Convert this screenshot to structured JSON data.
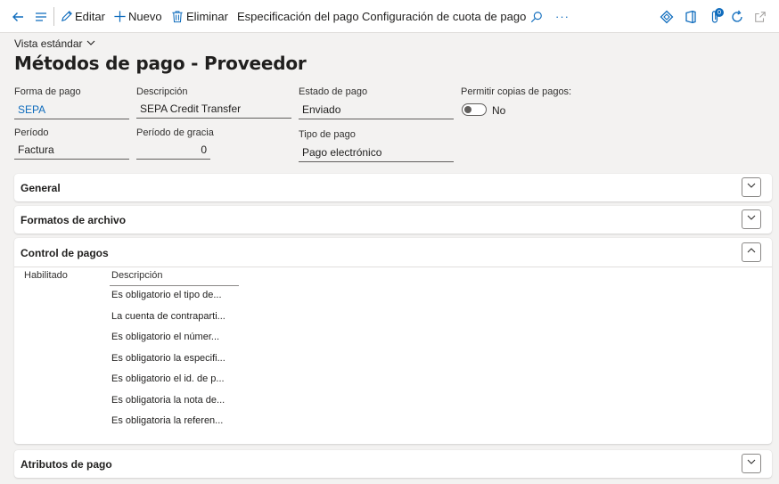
{
  "toolbar": {
    "edit_label": "Editar",
    "new_label": "Nuevo",
    "delete_label": "Eliminar",
    "payment_spec_label": "Especificación del pago",
    "fee_config_label": "Configuración de cuota de pago",
    "more_label": "···",
    "notification_count": "0"
  },
  "header": {
    "view_label": "Vista estándar",
    "title": "Métodos de pago - Proveedor"
  },
  "form": {
    "payment_method": {
      "label": "Forma de pago",
      "value": "SEPA"
    },
    "description": {
      "label": "Descripción",
      "value": "SEPA Credit Transfer"
    },
    "payment_status": {
      "label": "Estado de pago",
      "value": "Enviado"
    },
    "allow_copies": {
      "label": "Permitir copias de pagos:",
      "value": "No"
    },
    "period": {
      "label": "Período",
      "value": "Factura"
    },
    "grace_period": {
      "label": "Período de gracia",
      "value": "0"
    },
    "payment_type": {
      "label": "Tipo de pago",
      "value": "Pago electrónico"
    }
  },
  "sections": {
    "general": {
      "title": "General"
    },
    "file_formats": {
      "title": "Formatos de archivo"
    },
    "payment_control": {
      "title": "Control de pagos",
      "columns": {
        "enabled": "Habilitado",
        "description": "Descripción"
      },
      "rows": [
        "Es obligatorio el tipo de...",
        "La cuenta de contraparti...",
        "Es obligatorio el númer...",
        "Es obligatorio la especifi...",
        "Es obligatorio el id. de p...",
        "Es obligatoria la nota de...",
        "Es obligatoria la referen..."
      ]
    },
    "payment_attributes": {
      "title": "Atributos de pago"
    }
  }
}
